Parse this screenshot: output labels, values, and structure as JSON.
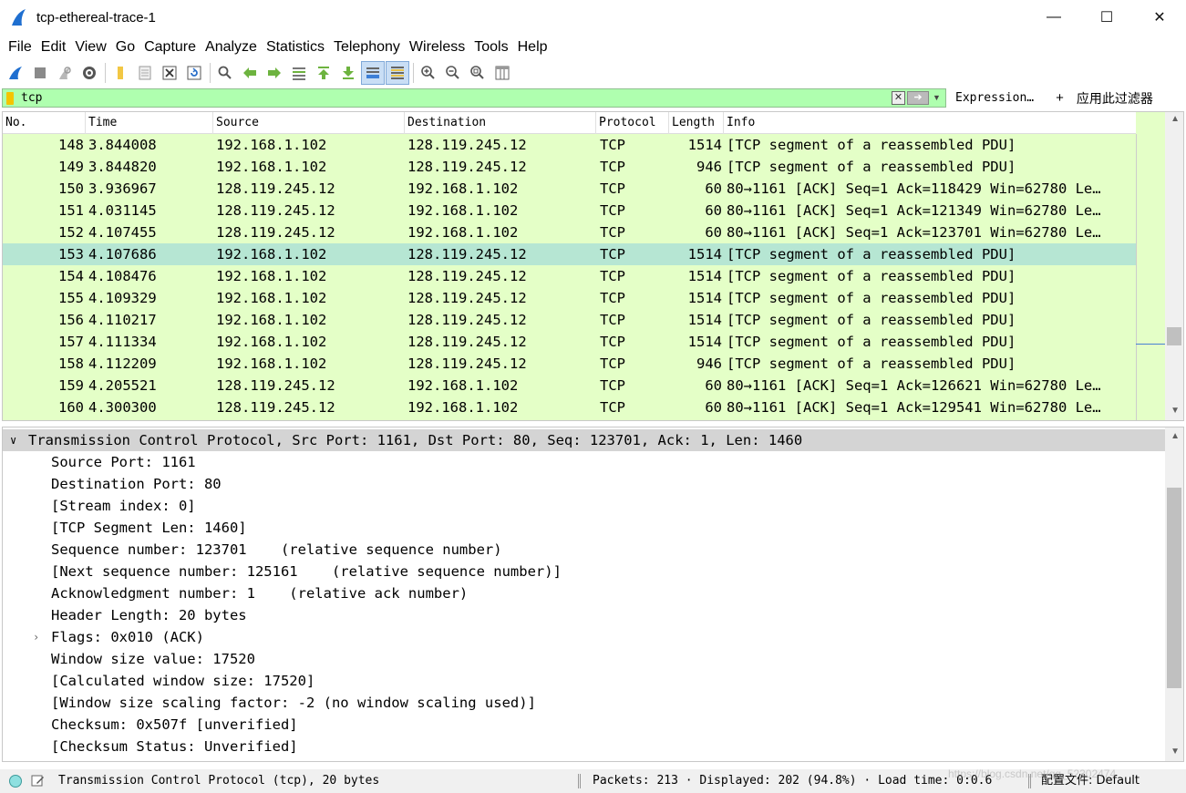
{
  "window": {
    "title": "tcp-ethereal-trace-1",
    "minimize": "—",
    "maximize": "☐",
    "close": "✕"
  },
  "menu": [
    "File",
    "Edit",
    "View",
    "Go",
    "Capture",
    "Analyze",
    "Statistics",
    "Telephony",
    "Wireless",
    "Tools",
    "Help"
  ],
  "filter": {
    "value": "tcp",
    "expression_label": "Expression…",
    "plus": "+",
    "apply_label": "应用此过滤器"
  },
  "packet_list": {
    "columns": [
      "No.",
      "Time",
      "Source",
      "Destination",
      "Protocol",
      "Length",
      "Info"
    ],
    "rows": [
      {
        "no": "148",
        "time": "3.844008",
        "src": "192.168.1.102",
        "dst": "128.119.245.12",
        "proto": "TCP",
        "len": "1514",
        "info": "[TCP segment of a reassembled PDU]"
      },
      {
        "no": "149",
        "time": "3.844820",
        "src": "192.168.1.102",
        "dst": "128.119.245.12",
        "proto": "TCP",
        "len": "946",
        "info": "[TCP segment of a reassembled PDU]"
      },
      {
        "no": "150",
        "time": "3.936967",
        "src": "128.119.245.12",
        "dst": "192.168.1.102",
        "proto": "TCP",
        "len": "60",
        "info": "80→1161 [ACK] Seq=1 Ack=118429 Win=62780 Le…"
      },
      {
        "no": "151",
        "time": "4.031145",
        "src": "128.119.245.12",
        "dst": "192.168.1.102",
        "proto": "TCP",
        "len": "60",
        "info": "80→1161 [ACK] Seq=1 Ack=121349 Win=62780 Le…"
      },
      {
        "no": "152",
        "time": "4.107455",
        "src": "128.119.245.12",
        "dst": "192.168.1.102",
        "proto": "TCP",
        "len": "60",
        "info": "80→1161 [ACK] Seq=1 Ack=123701 Win=62780 Le…"
      },
      {
        "no": "153",
        "time": "4.107686",
        "src": "192.168.1.102",
        "dst": "128.119.245.12",
        "proto": "TCP",
        "len": "1514",
        "info": "[TCP segment of a reassembled PDU]",
        "selected": true
      },
      {
        "no": "154",
        "time": "4.108476",
        "src": "192.168.1.102",
        "dst": "128.119.245.12",
        "proto": "TCP",
        "len": "1514",
        "info": "[TCP segment of a reassembled PDU]"
      },
      {
        "no": "155",
        "time": "4.109329",
        "src": "192.168.1.102",
        "dst": "128.119.245.12",
        "proto": "TCP",
        "len": "1514",
        "info": "[TCP segment of a reassembled PDU]"
      },
      {
        "no": "156",
        "time": "4.110217",
        "src": "192.168.1.102",
        "dst": "128.119.245.12",
        "proto": "TCP",
        "len": "1514",
        "info": "[TCP segment of a reassembled PDU]"
      },
      {
        "no": "157",
        "time": "4.111334",
        "src": "192.168.1.102",
        "dst": "128.119.245.12",
        "proto": "TCP",
        "len": "1514",
        "info": "[TCP segment of a reassembled PDU]"
      },
      {
        "no": "158",
        "time": "4.112209",
        "src": "192.168.1.102",
        "dst": "128.119.245.12",
        "proto": "TCP",
        "len": "946",
        "info": "[TCP segment of a reassembled PDU]"
      },
      {
        "no": "159",
        "time": "4.205521",
        "src": "128.119.245.12",
        "dst": "192.168.1.102",
        "proto": "TCP",
        "len": "60",
        "info": "80→1161 [ACK] Seq=1 Ack=126621 Win=62780 Le…"
      },
      {
        "no": "160",
        "time": "4.300300",
        "src": "128.119.245.12",
        "dst": "192.168.1.102",
        "proto": "TCP",
        "len": "60",
        "info": "80→1161 [ACK] Seq=1 Ack=129541 Win=62780 Le…"
      }
    ]
  },
  "detail": {
    "header": "Transmission Control Protocol, Src Port: 1161, Dst Port: 80, Seq: 123701, Ack: 1, Len: 1460",
    "lines": [
      {
        "text": "Source Port: 1161"
      },
      {
        "text": "Destination Port: 80"
      },
      {
        "text": "[Stream index: 0]"
      },
      {
        "text": "[TCP Segment Len: 1460]"
      },
      {
        "text": "Sequence number: 123701    (relative sequence number)"
      },
      {
        "text": "[Next sequence number: 125161    (relative sequence number)]"
      },
      {
        "text": "Acknowledgment number: 1    (relative ack number)"
      },
      {
        "text": "Header Length: 20 bytes"
      },
      {
        "text": "Flags: 0x010 (ACK)",
        "expandable": true
      },
      {
        "text": "Window size value: 17520"
      },
      {
        "text": "[Calculated window size: 17520]"
      },
      {
        "text": "[Window size scaling factor: -2 (no window scaling used)]"
      },
      {
        "text": "Checksum: 0x507f [unverified]"
      },
      {
        "text": "[Checksum Status: Unverified]"
      }
    ]
  },
  "status": {
    "field_info": "Transmission Control Protocol (tcp), 20 bytes",
    "packets": "Packets: 213 · Displayed: 202 (94.8%) · Load time: 0:0.6",
    "profile": "配置文件: Default",
    "watermark": "https://blog.csdn.net/qq_52302474"
  },
  "colors": {
    "filter_ok": "#afffaf",
    "tcp_row": "#e4ffc7",
    "selected_row": "#b6e6d3",
    "detail_header": "#d4d4d4"
  }
}
